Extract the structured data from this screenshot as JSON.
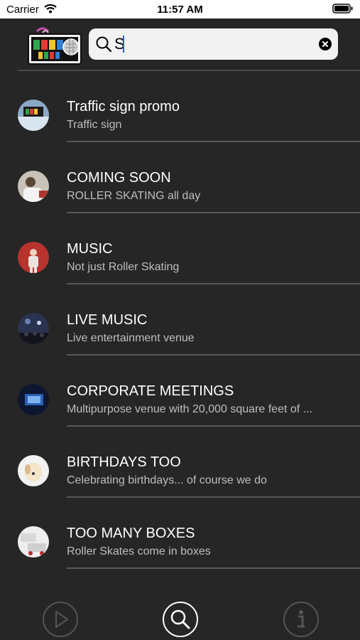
{
  "status_bar": {
    "carrier": "Carrier",
    "time": "11:57 AM"
  },
  "header": {
    "logo_icon": "disco-ball-events-logo",
    "search": {
      "value": "S",
      "placeholder": ""
    }
  },
  "list": {
    "items": [
      {
        "title": "Traffic sign promo",
        "subtitle": "Traffic sign",
        "thumb_colors": [
          "#8aa9c7",
          "#d8e4ef"
        ]
      },
      {
        "title": "COMING SOON",
        "subtitle": "ROLLER SKATING all day",
        "thumb_colors": [
          "#c9c2b8",
          "#5a4636"
        ]
      },
      {
        "title": "MUSIC",
        "subtitle": "Not just Roller Skating",
        "thumb_colors": [
          "#b8322e",
          "#e9e4e0"
        ]
      },
      {
        "title": "LIVE MUSIC",
        "subtitle": "Live entertainment venue",
        "thumb_colors": [
          "#2a3350",
          "#6b7fb0"
        ]
      },
      {
        "title": "CORPORATE MEETINGS",
        "subtitle": "Multipurpose venue with 20,000 square feet of ...",
        "thumb_colors": [
          "#0d1630",
          "#3f7fd4"
        ]
      },
      {
        "title": "BIRTHDAYS TOO",
        "subtitle": "Celebrating birthdays... of course we do",
        "thumb_colors": [
          "#f2f2f2",
          "#d9b98e"
        ]
      },
      {
        "title": "TOO MANY BOXES",
        "subtitle": "Roller Skates come in boxes",
        "thumb_colors": [
          "#eeeeee",
          "#b42b2b"
        ]
      }
    ]
  },
  "tabbar": {
    "tabs": [
      {
        "icon": "play-icon",
        "active": false
      },
      {
        "icon": "search-icon",
        "active": true
      },
      {
        "icon": "info-icon",
        "active": false
      }
    ]
  },
  "colors": {
    "background": "#262626",
    "accent": "#ffffff",
    "separator": "#575757"
  }
}
